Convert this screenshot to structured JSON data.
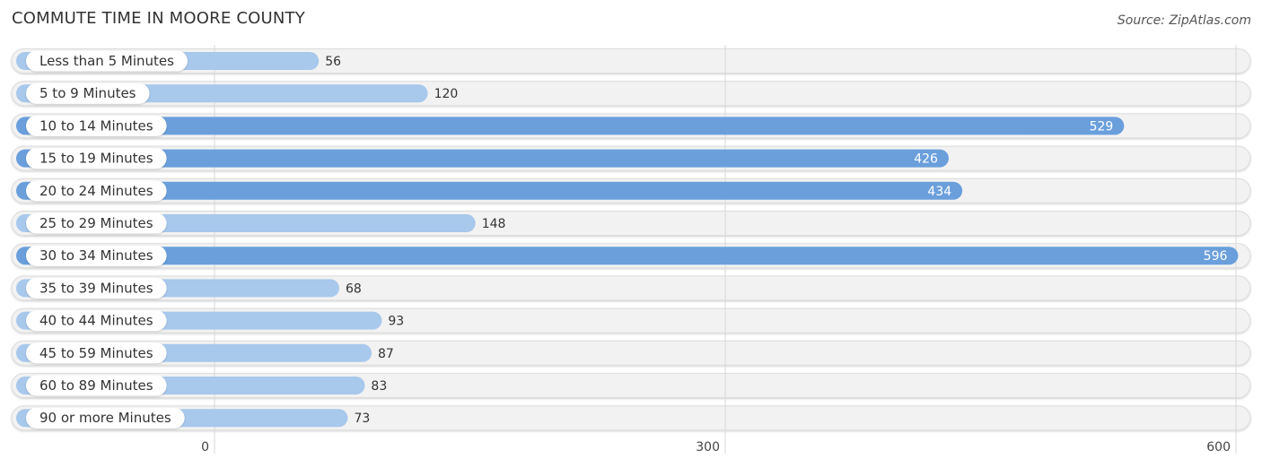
{
  "chart_data": {
    "type": "bar",
    "orientation": "horizontal",
    "title": "COMMUTE TIME IN MOORE COUNTY",
    "source": "Source: ZipAtlas.com",
    "xlabel": "",
    "ylabel": "",
    "categories": [
      "Less than 5 Minutes",
      "5 to 9 Minutes",
      "10 to 14 Minutes",
      "15 to 19 Minutes",
      "20 to 24 Minutes",
      "25 to 29 Minutes",
      "30 to 34 Minutes",
      "35 to 39 Minutes",
      "40 to 44 Minutes",
      "45 to 59 Minutes",
      "60 to 89 Minutes",
      "90 or more Minutes"
    ],
    "values": [
      56,
      120,
      529,
      426,
      434,
      148,
      596,
      68,
      93,
      87,
      83,
      73
    ],
    "xlim": [
      0,
      600
    ],
    "xticks": [
      0,
      300,
      600
    ],
    "xtick_labels": [
      "0",
      "300",
      "600"
    ],
    "grid": true,
    "colors": {
      "strong": "#6a9fdc",
      "light": "#a8c8ec",
      "track": "#f2f2f2"
    }
  }
}
